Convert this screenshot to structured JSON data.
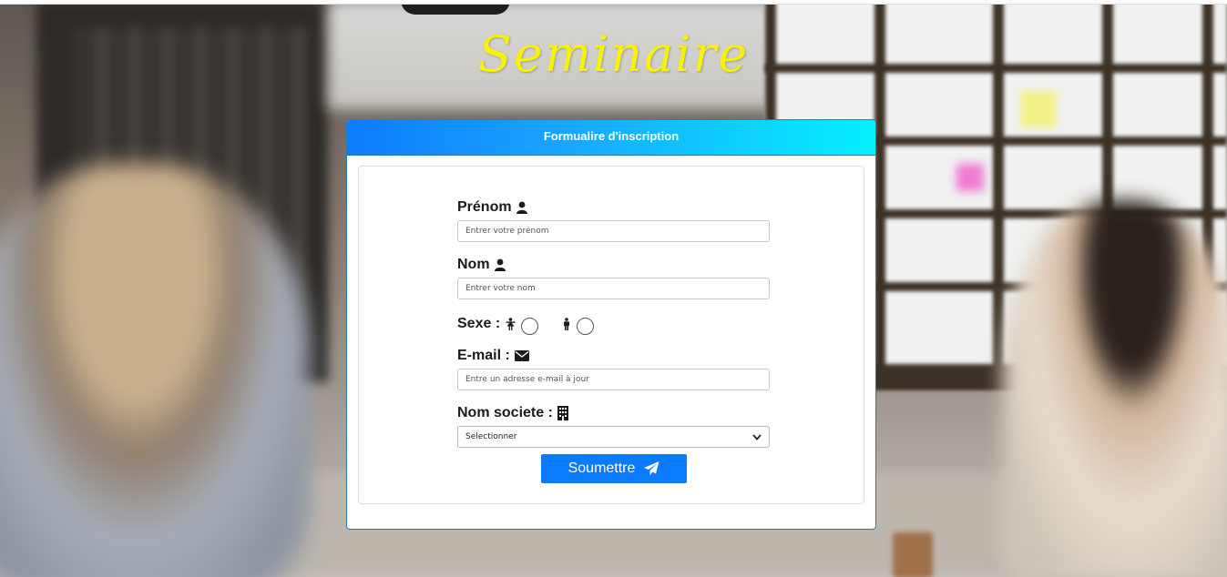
{
  "page": {
    "title": "Seminaire"
  },
  "card": {
    "header": "Formualire d'inscription"
  },
  "form": {
    "prenom": {
      "label": "Prénom",
      "placeholder": "Entrer votre prénom",
      "icon": "user-icon"
    },
    "nom": {
      "label": "Nom",
      "placeholder": "Entrer votre nom",
      "icon": "user-icon"
    },
    "sexe": {
      "label": "Sexe :",
      "options": [
        {
          "icon": "female-icon",
          "selected": false
        },
        {
          "icon": "male-icon",
          "selected": false
        }
      ]
    },
    "email": {
      "label": "E-mail :",
      "placeholder": "Entre un adresse e-mail à jour",
      "icon": "envelope-icon"
    },
    "societe": {
      "label": "Nom societe :",
      "selected": "Selectionner",
      "icon": "building-icon"
    },
    "submit": {
      "label": "Soumettre",
      "icon": "paper-plane-icon"
    }
  },
  "colors": {
    "title": "#f8f20a",
    "button": "#0a7bff",
    "header_start": "#0d7bff",
    "header_end": "#05f0ff"
  }
}
